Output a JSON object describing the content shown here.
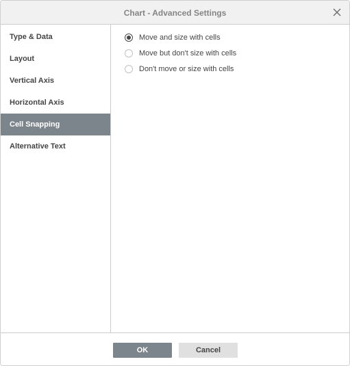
{
  "dialog": {
    "title": "Chart - Advanced Settings",
    "close_icon": "close-icon"
  },
  "sidebar": {
    "items": [
      {
        "label": "Type & Data",
        "active": false
      },
      {
        "label": "Layout",
        "active": false
      },
      {
        "label": "Vertical Axis",
        "active": false
      },
      {
        "label": "Horizontal Axis",
        "active": false
      },
      {
        "label": "Cell Snapping",
        "active": true
      },
      {
        "label": "Alternative Text",
        "active": false
      }
    ]
  },
  "cell_snapping": {
    "options": [
      {
        "label": "Move and size with cells",
        "checked": true
      },
      {
        "label": "Move but don't size with cells",
        "checked": false
      },
      {
        "label": "Don't move or size with cells",
        "checked": false
      }
    ]
  },
  "footer": {
    "ok_label": "OK",
    "cancel_label": "Cancel"
  },
  "colors": {
    "accent": "#7d858c",
    "header_bg": "#f1f1f1",
    "text": "#444444"
  }
}
